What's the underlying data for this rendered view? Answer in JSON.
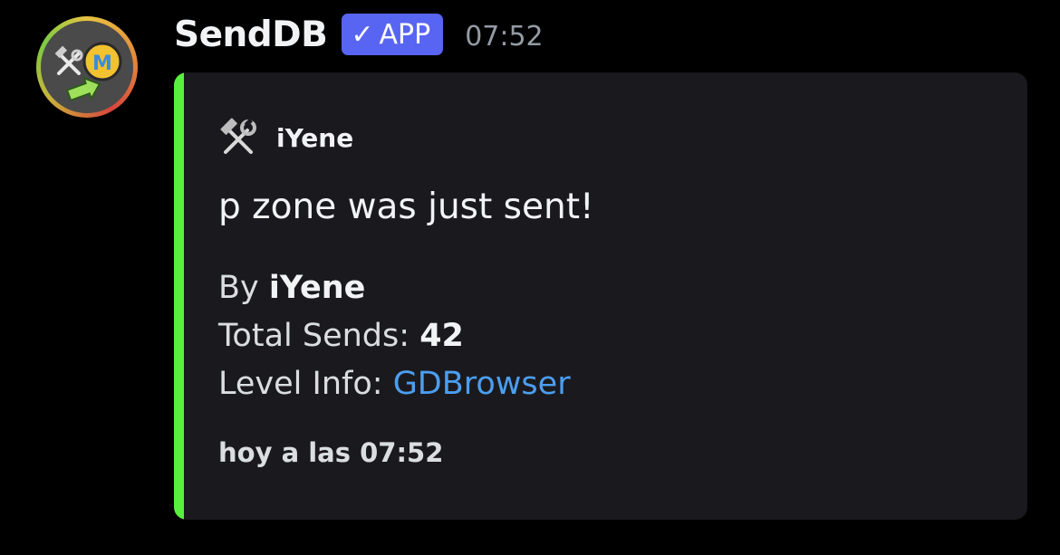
{
  "message": {
    "author": "SendDB",
    "badge": {
      "check": "✓",
      "label": "APP",
      "color": "#5865f2"
    },
    "timestamp": "07:52",
    "avatar_icon": "bot-avatar-icon"
  },
  "embed": {
    "accent_color": "#57f13d",
    "author": {
      "icon": "hammer-and-wrench-icon",
      "name": "iYene"
    },
    "title": "p zone was just sent!",
    "fields": {
      "by_label": "By",
      "by_value": "iYene",
      "sends_label": "Total Sends:",
      "sends_value": "42",
      "level_label": "Level Info:",
      "level_link": "GDBrowser"
    },
    "footer": "hoy a las 07:52"
  }
}
